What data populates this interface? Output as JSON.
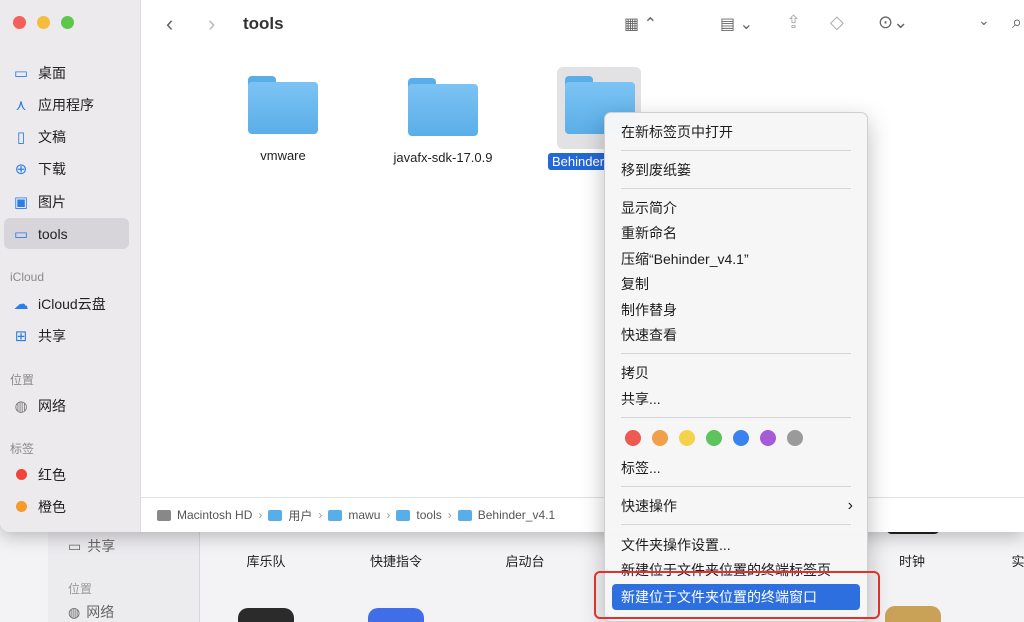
{
  "background": {
    "sidebar": {
      "share": "共享",
      "location_head": "位置",
      "network": "网络"
    },
    "dock_labels": [
      "库乐队",
      "快捷指令",
      "启动台",
      "时钟",
      "实"
    ]
  },
  "window": {
    "title": "tools",
    "sidebar": {
      "items": [
        {
          "icon": "desktop-icon",
          "label": "桌面"
        },
        {
          "icon": "applications-icon",
          "label": "应用程序"
        },
        {
          "icon": "documents-icon",
          "label": "文稿"
        },
        {
          "icon": "downloads-icon",
          "label": "下载"
        },
        {
          "icon": "pictures-icon",
          "label": "图片"
        },
        {
          "icon": "folder-icon",
          "label": "tools"
        }
      ],
      "icloud_head": "iCloud",
      "icloud_items": [
        {
          "icon": "cloud-icon",
          "label": "iCloud云盘"
        },
        {
          "icon": "shared-icon",
          "label": "共享"
        }
      ],
      "location_head": "位置",
      "location_items": [
        {
          "icon": "network-icon",
          "label": "网络"
        }
      ],
      "tags_head": "标签",
      "tags": [
        {
          "label": "红色",
          "color": "#f0443a"
        },
        {
          "label": "橙色",
          "color": "#f39b2b"
        }
      ]
    },
    "folders": [
      "vmware",
      "javafx-sdk-17.0.9",
      "Behinder"
    ],
    "pathbar": [
      "Macintosh HD",
      "用户",
      "mawu",
      "tools",
      "Behinder_v4.1"
    ]
  },
  "context_menu": {
    "items": [
      "在新标签页中打开",
      "移到废纸篓",
      "显示简介",
      "重新命名",
      "压缩“Behinder_v4.1”",
      "复制",
      "制作替身",
      "快速查看",
      "拷贝",
      "共享...",
      "标签...",
      "快速操作",
      "文件夹操作设置...",
      "新建位于文件夹位置的终端标签页",
      "新建位于文件夹位置的终端窗口"
    ],
    "tag_colors": [
      "#ec5a52",
      "#f0a04a",
      "#f5d24c",
      "#5ec35a",
      "#3a82f0",
      "#a55bd6",
      "#9a9a9a"
    ]
  }
}
